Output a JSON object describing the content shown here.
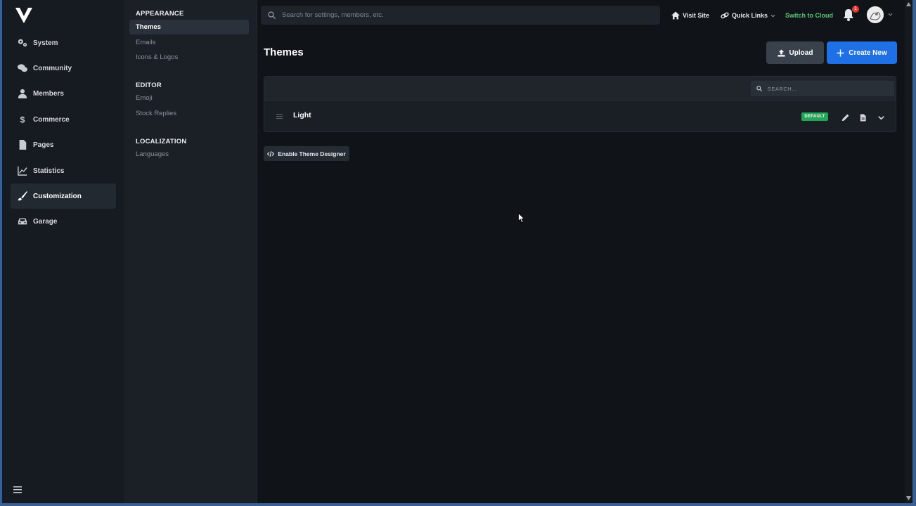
{
  "app": {
    "logo": "v-logo"
  },
  "nav": {
    "items": [
      {
        "label": "System",
        "icon": "gears-icon"
      },
      {
        "label": "Community",
        "icon": "comments-icon"
      },
      {
        "label": "Members",
        "icon": "user-icon"
      },
      {
        "label": "Commerce",
        "icon": "dollar-icon"
      },
      {
        "label": "Pages",
        "icon": "file-icon"
      },
      {
        "label": "Statistics",
        "icon": "chart-line-icon"
      },
      {
        "label": "Customization",
        "icon": "brush-icon",
        "active": true
      },
      {
        "label": "Garage",
        "icon": "car-icon"
      }
    ]
  },
  "subnav": {
    "sections": [
      {
        "heading": "APPEARANCE",
        "items": [
          "Themes",
          "Emails",
          "Icons & Logos"
        ]
      },
      {
        "heading": "EDITOR",
        "items": [
          "Emoji",
          "Stock Replies"
        ]
      },
      {
        "heading": "LOCALIZATION",
        "items": [
          "Languages"
        ]
      }
    ],
    "active_item": "Themes"
  },
  "topbar": {
    "search_placeholder": "Search for settings, members, etc.",
    "visit_site": "Visit Site",
    "quick_links": "Quick Links",
    "switch_cloud": "Switch to Cloud",
    "notification_count": "1"
  },
  "main": {
    "title": "Themes",
    "upload_label": "Upload",
    "create_label": "Create New",
    "table_search_placeholder": "SEARCH...",
    "rows": [
      {
        "name": "Light",
        "badge": "DEFAULT"
      }
    ],
    "designer_label": "Enable Theme Designer"
  },
  "colors": {
    "accent": "#1f6fe5",
    "success": "#25a55a",
    "cloud_text": "#54c97a",
    "badge_red": "#e53935"
  }
}
